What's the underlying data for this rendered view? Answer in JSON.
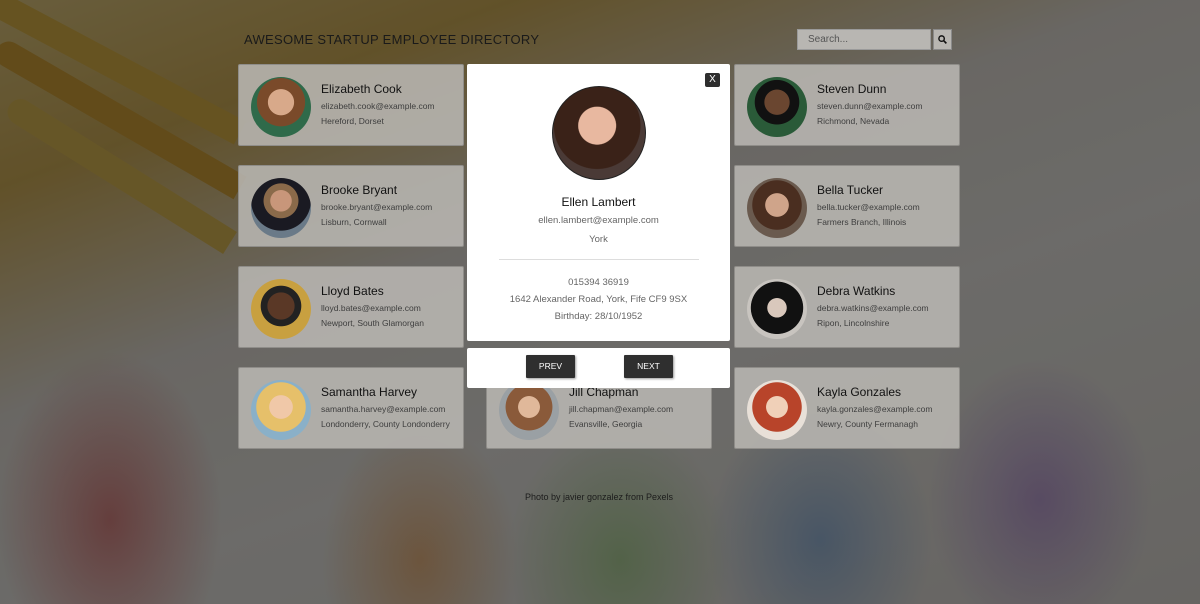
{
  "header": {
    "title": "AWESOME STARTUP EMPLOYEE DIRECTORY",
    "search_placeholder": "Search..."
  },
  "employees": [
    {
      "name": "Elizabeth Cook",
      "email": "elizabeth.cook@example.com",
      "location": "Hereford, Dorset"
    },
    {
      "name": "Steven Dunn",
      "email": "steven.dunn@example.com",
      "location": "Richmond, Nevada"
    },
    {
      "name": "Brooke Bryant",
      "email": "brooke.bryant@example.com",
      "location": "Lisburn, Cornwall"
    },
    {
      "name": "Bella Tucker",
      "email": "bella.tucker@example.com",
      "location": "Farmers Branch, Illinois"
    },
    {
      "name": "Lloyd Bates",
      "email": "lloyd.bates@example.com",
      "location": "Newport, South Glamorgan"
    },
    {
      "name": "Debra Watkins",
      "email": "debra.watkins@example.com",
      "location": "Ripon, Lincolnshire"
    },
    {
      "name": "Samantha Harvey",
      "email": "samantha.harvey@example.com",
      "location": "Londonderry, County Londonderry"
    },
    {
      "name": "Jill Chapman",
      "email": "jill.chapman@example.com",
      "location": "Evansville, Georgia"
    },
    {
      "name": "Kayla Gonzales",
      "email": "kayla.gonzales@example.com",
      "location": "Newry, County Fermanagh"
    }
  ],
  "modal": {
    "close_label": "X",
    "name": "Ellen Lambert",
    "email": "ellen.lambert@example.com",
    "city": "York",
    "phone": "015394 36919",
    "address": "1642 Alexander Road, York, Fife CF9 9SX",
    "birthday": "Birthday: 28/10/1952",
    "prev_label": "PREV",
    "next_label": "NEXT"
  },
  "footer": {
    "credit": "Photo by javier gonzalez from Pexels"
  }
}
